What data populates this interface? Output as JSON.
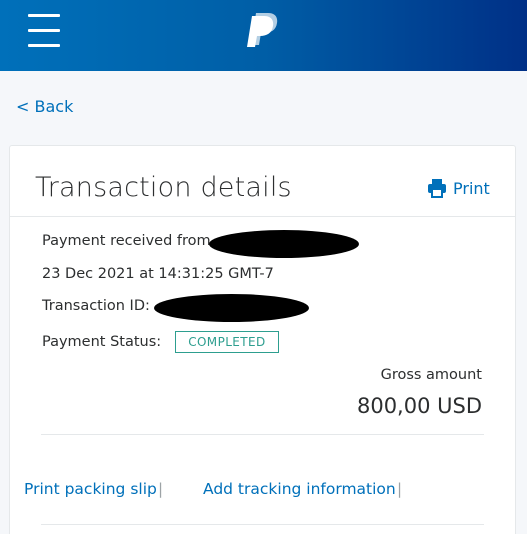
{
  "header": {
    "menu_icon": "hamburger-menu-icon",
    "logo_icon": "paypal-logo-icon",
    "colors": {
      "gradient_start": "#0070ba",
      "gradient_end": "#003087"
    }
  },
  "nav": {
    "back_label": "< Back"
  },
  "card": {
    "title": "Transaction details",
    "print_label": "Print",
    "print_icon": "printer-icon",
    "payment_received_label": "Payment received from",
    "date": "23 Dec 2021 at 14:31:25 GMT-7",
    "transaction_id_label": "Transaction ID:",
    "payment_status_label": "Payment Status:",
    "status": "COMPLETED",
    "status_color": "#2d9e8f",
    "gross_label": "Gross amount",
    "gross_value": "800,00 USD"
  },
  "actions": {
    "print_packing_slip": "Print packing slip",
    "add_tracking": "Add tracking information",
    "separator": "|"
  },
  "colors": {
    "link": "#0070ba",
    "text": "#2c2e2f"
  }
}
